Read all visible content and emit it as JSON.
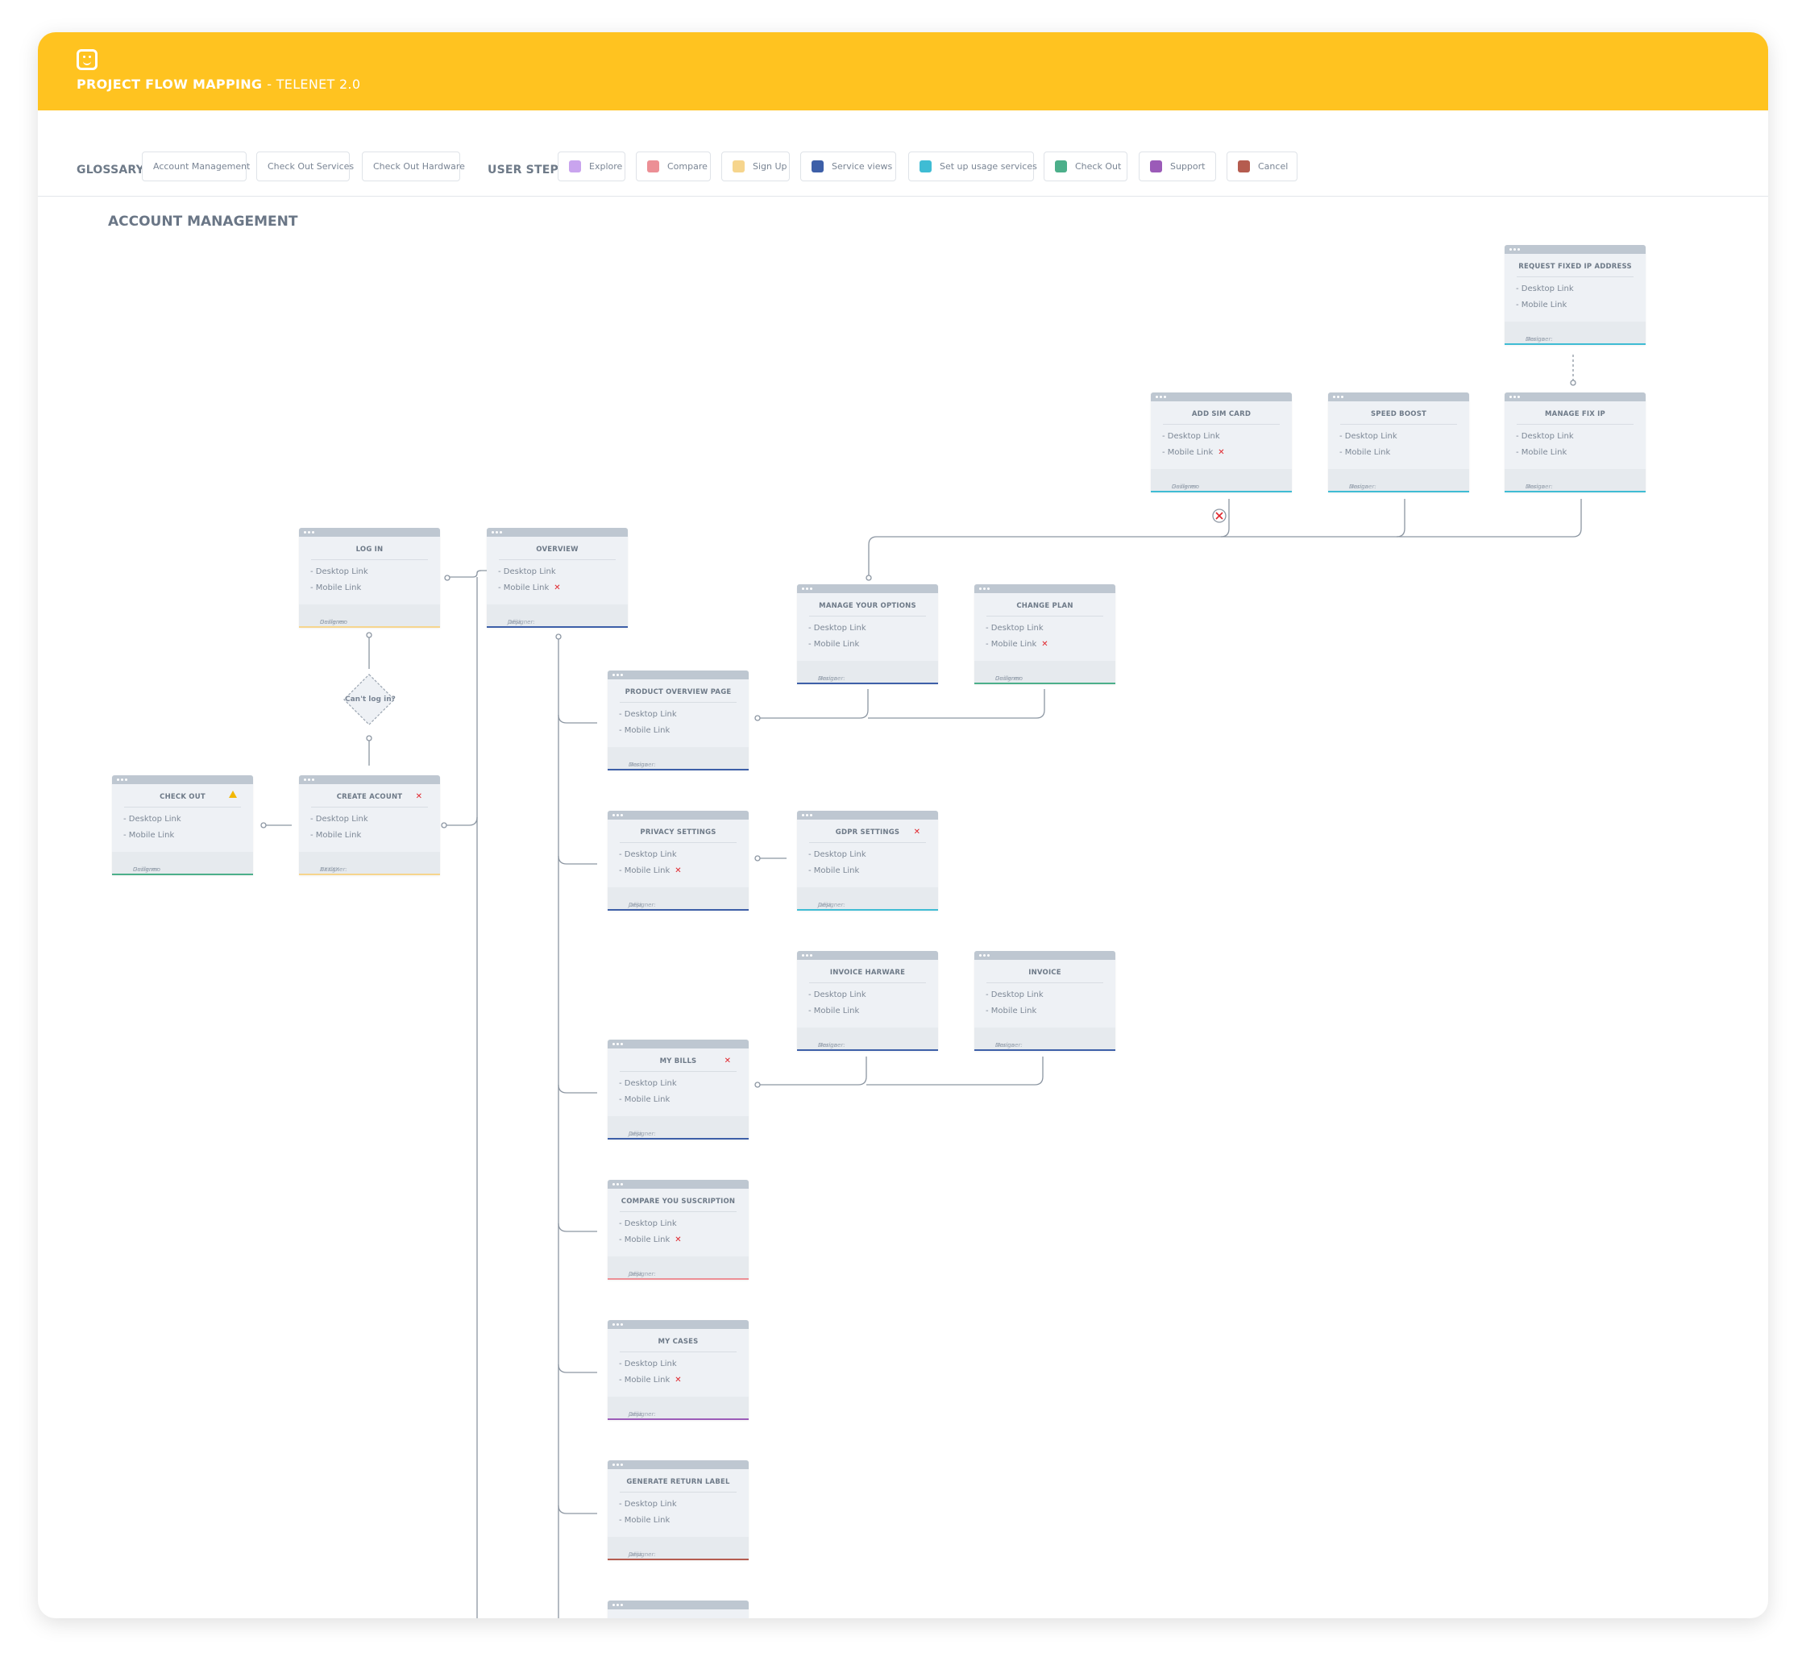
{
  "header": {
    "logo_icon": "smiley-logo-icon",
    "title": "PROJECT FLOW MAPPING",
    "subtitle": "- TELENET 2.0",
    "background_color": "#ffc320"
  },
  "glossary": {
    "label": "GLOSSARY",
    "items": [
      "Account Management",
      "Check Out Services",
      "Check Out Hardware"
    ]
  },
  "user_steps": {
    "label": "USER STEPS",
    "items": [
      {
        "label": "Explore",
        "color": "#c9a4ee"
      },
      {
        "label": "Compare",
        "color": "#ec8f95"
      },
      {
        "label": "Sign Up",
        "color": "#f6d58d"
      },
      {
        "label": "Service views",
        "color": "#3d5fa8"
      },
      {
        "label": "Set up usage services",
        "color": "#3fbcd4"
      },
      {
        "label": "Check Out",
        "color": "#4caf8a"
      },
      {
        "label": "Support",
        "color": "#9b5bb8"
      },
      {
        "label": "Cancel",
        "color": "#b55c4f"
      }
    ]
  },
  "section": {
    "title": "ACCOUNT MANAGEMENT"
  },
  "decision": {
    "label": "Can't log in?"
  },
  "nodes": {
    "request_fixed_ip": {
      "title": "REQUEST FIXED IP ADDRESS",
      "line1": "- Desktop Link",
      "line2": "- Mobile Link",
      "designer_label": "Designer:",
      "designer": "Marina",
      "accent": "#3fbcd4"
    },
    "add_sim": {
      "title": "ADD SIM CARD",
      "line1": "- Desktop Link",
      "line2": "- Mobile Link",
      "designer_label": "Designer:",
      "designer": "Guillermo",
      "accent": "#3fbcd4"
    },
    "speed_boost": {
      "title": "SPEED BOOST",
      "line1": "- Desktop Link",
      "line2": "- Mobile Link",
      "designer_label": "Designer:",
      "designer": "Marina",
      "accent": "#3fbcd4"
    },
    "manage_fix_ip": {
      "title": "MANAGE FIX IP",
      "line1": "- Desktop Link",
      "line2": "- Mobile Link",
      "designer_label": "Designer:",
      "designer": "Marina",
      "accent": "#3fbcd4"
    },
    "log_in": {
      "title": "LOG IN",
      "line1": "- Desktop Link",
      "line2": "- Mobile Link",
      "designer_label": "Designer:",
      "designer": "Guillermo",
      "accent": "#f6d58d"
    },
    "overview": {
      "title": "OVERVIEW",
      "line1": "- Desktop Link",
      "line2": "- Mobile Link",
      "designer_label": "Designer:",
      "designer": "Julija",
      "accent": "#3d5fa8"
    },
    "manage_options": {
      "title": "MANAGE YOUR OPTIONS",
      "line1": "- Desktop Link",
      "line2": "- Mobile Link",
      "designer_label": "Designer:",
      "designer": "Marina",
      "accent": "#3d5fa8"
    },
    "change_plan": {
      "title": "CHANGE PLAN",
      "line1": "- Desktop Link",
      "line2": "- Mobile Link",
      "designer_label": "Designer:",
      "designer": "Guillermo",
      "accent": "#4caf8a"
    },
    "product_overview": {
      "title": "PRODUCT OVERVIEW PAGE",
      "line1": "- Desktop Link",
      "line2": "- Mobile Link",
      "designer_label": "Designer:",
      "designer": "Marina",
      "accent": "#3d5fa8"
    },
    "check_out": {
      "title": "CHECK OUT",
      "line1": "- Desktop Link",
      "line2": "- Mobile Link",
      "designer_label": "Designer:",
      "designer": "Guillermo",
      "accent": "#4caf8a"
    },
    "create_account": {
      "title": "CREATE ACOUNT",
      "line1": "- Desktop Link",
      "line2": "- Mobile Link",
      "designer_label": "Designer:",
      "designer": "XXXXX",
      "accent": "#f6d58d"
    },
    "privacy_settings": {
      "title": "PRIVACY SETTINGS",
      "line1": "- Desktop Link",
      "line2": "- Mobile Link",
      "designer_label": "Designer:",
      "designer": "Julija",
      "accent": "#3d5fa8"
    },
    "gdpr_settings": {
      "title": "GDPR SETTINGS",
      "line1": "- Desktop Link",
      "line2": "- Mobile Link",
      "designer_label": "Designer:",
      "designer": "Julija",
      "accent": "#3fbcd4"
    },
    "invoice_hardware": {
      "title": "INVOICE HARWARE",
      "line1": "- Desktop Link",
      "line2": "- Mobile Link",
      "designer_label": "Designer:",
      "designer": "Marina",
      "accent": "#3d5fa8"
    },
    "invoice": {
      "title": "INVOICE",
      "line1": "- Desktop Link",
      "line2": "- Mobile Link",
      "designer_label": "Designer:",
      "designer": "Marina",
      "accent": "#3d5fa8"
    },
    "my_bills": {
      "title": "MY BILLS",
      "line1": "- Desktop Link",
      "line2": "- Mobile Link",
      "designer_label": "Designer:",
      "designer": "Julija",
      "accent": "#3d5fa8"
    },
    "compare_subscription": {
      "title": "COMPARE YOU SUSCRIPTION",
      "line1": "- Desktop Link",
      "line2": "- Mobile Link",
      "designer_label": "Designer:",
      "designer": "Julija",
      "accent": "#ec8f95"
    },
    "my_cases": {
      "title": "MY CASES",
      "line1": "- Desktop Link",
      "line2": "- Mobile Link",
      "designer_label": "Designer:",
      "designer": "Julija",
      "accent": "#9b5bb8"
    },
    "generate_return_label": {
      "title": "GENERATE RETURN LABEL",
      "line1": "- Desktop Link",
      "line2": "- Mobile Link",
      "designer_label": "Designer:",
      "designer": "Julija",
      "accent": "#b55c4f"
    },
    "partial_node": {
      "title": "",
      "line1": "",
      "line2": "",
      "designer_label": "",
      "designer": "",
      "accent": "#3d5fa8"
    }
  }
}
